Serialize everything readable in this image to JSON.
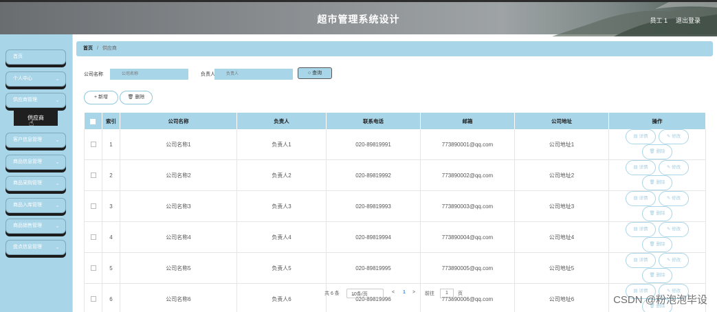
{
  "header": {
    "title": "超市管理系统设计",
    "user": "员工 1",
    "logout": "退出登录"
  },
  "sidebar": {
    "items": [
      {
        "label": "首页",
        "chevron": ""
      },
      {
        "label": "个人中心",
        "chevron": "⌄"
      },
      {
        "label": "供应商管理",
        "chevron": "⌄"
      },
      {
        "label": "客户信息管理",
        "chevron": "⌄"
      },
      {
        "label": "商品信息管理",
        "chevron": "⌄"
      },
      {
        "label": "商品采购管理",
        "chevron": "⌄"
      },
      {
        "label": "商品入库管理",
        "chevron": "⌄"
      },
      {
        "label": "商品销售管理",
        "chevron": "⌄"
      },
      {
        "label": "盘点信息管理",
        "chevron": "⌄"
      }
    ],
    "active_sub": "供应商"
  },
  "breadcrumb": {
    "home": "首页",
    "sep": "/",
    "current": "供应商"
  },
  "search": {
    "company_label": "公司名称",
    "company_placeholder": "公司名称",
    "person_label": "负责人",
    "person_placeholder": "负责人",
    "query": "查询"
  },
  "actions": {
    "add": "+ 新增",
    "delete": "删除"
  },
  "table": {
    "headers": [
      "索引",
      "公司名称",
      "负责人",
      "联系电话",
      "邮箱",
      "公司地址",
      "操作"
    ],
    "rows": [
      {
        "idx": "1",
        "company": "公司名称1",
        "person": "负责人1",
        "phone": "020-89819991",
        "email": "773890001@qq.com",
        "address": "公司地址1"
      },
      {
        "idx": "2",
        "company": "公司名称2",
        "person": "负责人2",
        "phone": "020-89819992",
        "email": "773890002@qq.com",
        "address": "公司地址2"
      },
      {
        "idx": "3",
        "company": "公司名称3",
        "person": "负责人3",
        "phone": "020-89819993",
        "email": "773890003@qq.com",
        "address": "公司地址3"
      },
      {
        "idx": "4",
        "company": "公司名称4",
        "person": "负责人4",
        "phone": "020-89819994",
        "email": "773890004@qq.com",
        "address": "公司地址4"
      },
      {
        "idx": "5",
        "company": "公司名称5",
        "person": "负责人5",
        "phone": "020-89819995",
        "email": "773890005@qq.com",
        "address": "公司地址5"
      },
      {
        "idx": "6",
        "company": "公司名称6",
        "person": "负责人6",
        "phone": "020-89819996",
        "email": "773890006@qq.com",
        "address": "公司地址6"
      }
    ],
    "ops": {
      "detail": "详情",
      "edit": "修改",
      "delete": "删除"
    }
  },
  "pager": {
    "total": "共 6 条",
    "page_size": "10条/页",
    "prev": "<",
    "page": "1",
    "next": ">",
    "goto": "前往",
    "goto_value": "1",
    "unit": "页"
  },
  "watermark": "CSDN @粉泡泡毕设",
  "colors": {
    "accent": "#a8d5e8",
    "dark": "#1f1f1f"
  }
}
